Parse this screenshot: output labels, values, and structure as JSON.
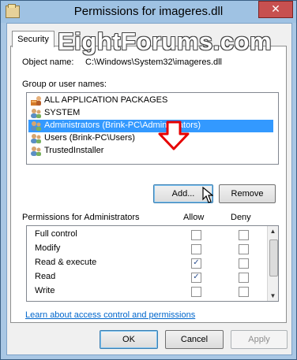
{
  "window": {
    "title": "Permissions for imageres.dll",
    "close_label": "✕"
  },
  "watermark": "EightForums.com",
  "tabs": [
    {
      "label": "Security"
    }
  ],
  "object": {
    "label": "Object name:",
    "value": "C:\\Windows\\System32\\imageres.dll"
  },
  "groups": {
    "label": "Group or user names:",
    "items": [
      {
        "label": "ALL APPLICATION PACKAGES",
        "icon": "package-user-icon",
        "selected": false
      },
      {
        "label": "SYSTEM",
        "icon": "users-icon",
        "selected": false
      },
      {
        "label": "Administrators (Brink-PC\\Administrators)",
        "icon": "users-icon",
        "selected": true
      },
      {
        "label": "Users (Brink-PC\\Users)",
        "icon": "users-icon",
        "selected": false
      },
      {
        "label": "TrustedInstaller",
        "icon": "users-icon",
        "selected": false
      }
    ]
  },
  "buttons": {
    "add": "Add...",
    "remove": "Remove",
    "ok": "OK",
    "cancel": "Cancel",
    "apply": "Apply"
  },
  "permissions": {
    "label": "Permissions for Administrators",
    "allow_header": "Allow",
    "deny_header": "Deny",
    "rows": [
      {
        "name": "Full control",
        "allow": false,
        "deny": false
      },
      {
        "name": "Modify",
        "allow": false,
        "deny": false
      },
      {
        "name": "Read & execute",
        "allow": true,
        "deny": false
      },
      {
        "name": "Read",
        "allow": true,
        "deny": false
      },
      {
        "name": "Write",
        "allow": false,
        "deny": false
      }
    ]
  },
  "link": "Learn about access control and permissions",
  "colors": {
    "selection": "#3399ff",
    "titlebar": "#9fc2e3",
    "close": "#c75050",
    "arrow": "#e60000"
  }
}
